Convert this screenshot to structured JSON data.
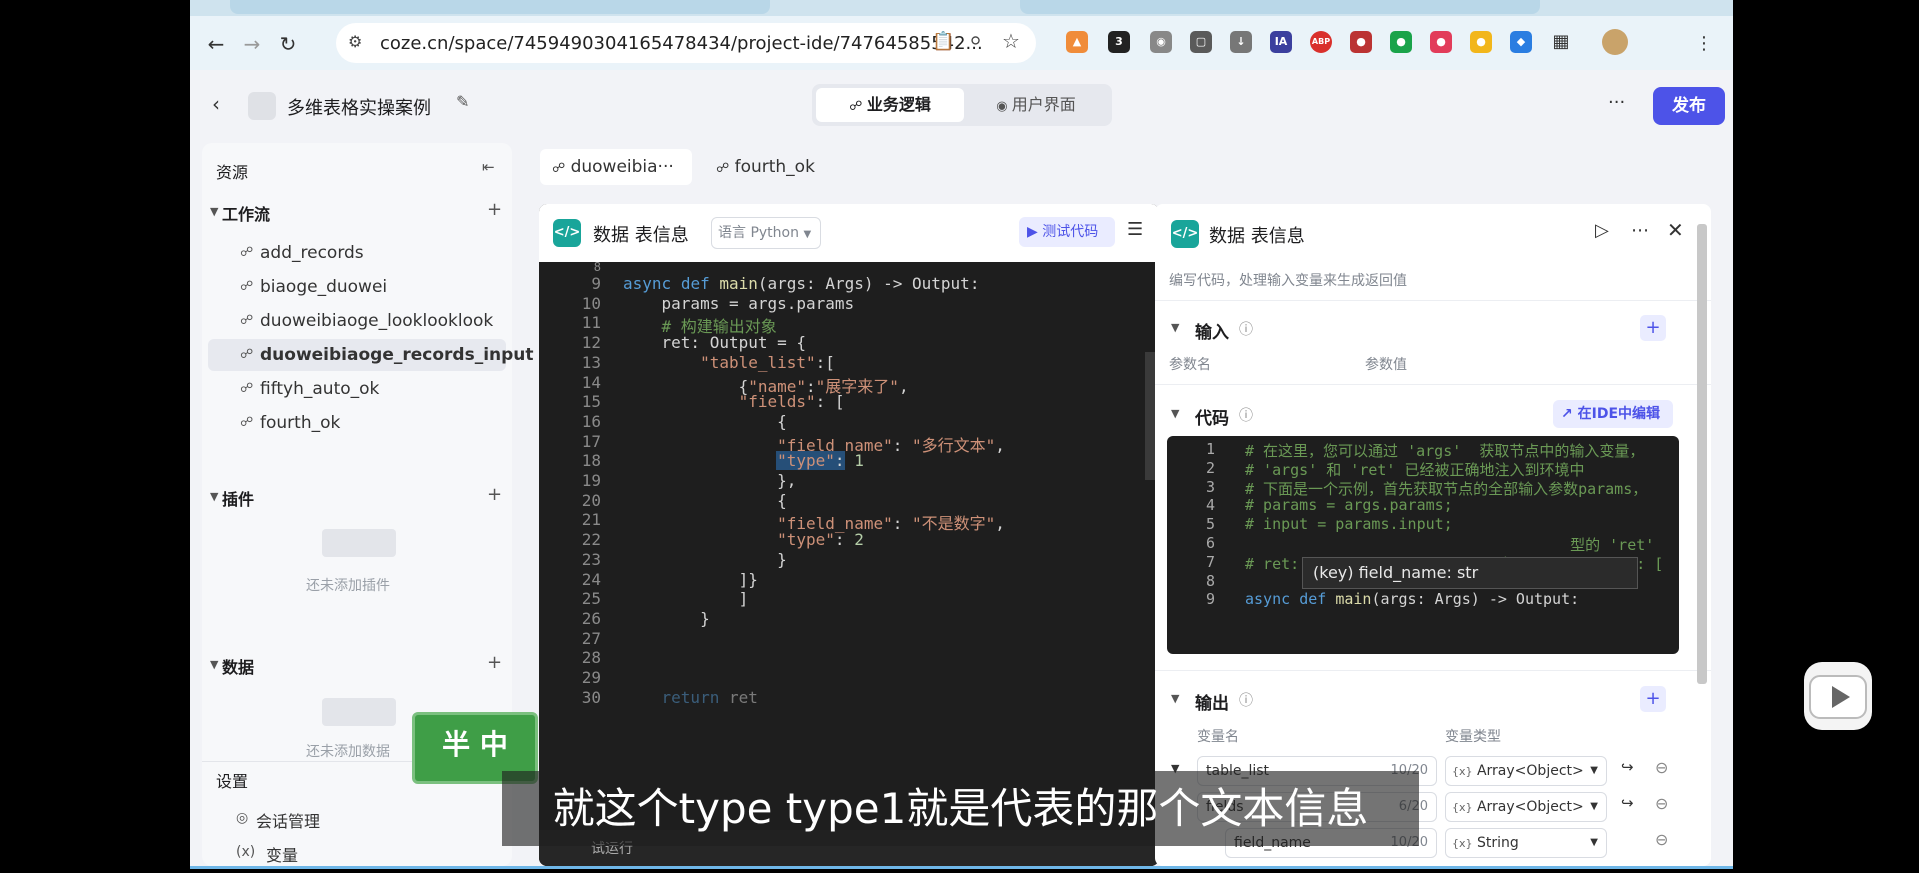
{
  "browser": {
    "url": "coze.cn/space/7459490304165478434/project-ide/74764585542...",
    "ext_badge": "3",
    "ext_ia": "IA",
    "ext_abp": "ABP"
  },
  "app": {
    "project_title": "多维表格实操案例",
    "seg_logic": "业务逻辑",
    "seg_ui": "用户界面",
    "more": "···",
    "publish": "发布"
  },
  "sidebar": {
    "resources": "资源",
    "workflow": "工作流",
    "plugins": "插件",
    "plugins_empty": "还未添加插件",
    "data": "数据",
    "data_empty": "还未添加数据",
    "settings": "设置",
    "session": "会话管理",
    "variables": "变量",
    "items": [
      "add_records",
      "biaoge_duowei",
      "duoweibiaoge_looklooklook",
      "duoweibiaoge_records_input",
      "fiftyh_auto_ok",
      "fourth_ok"
    ]
  },
  "editor_tabs": [
    "duoweibia···",
    "fourth_ok"
  ],
  "node": {
    "title": "数据 表信息",
    "lang": "语言 Python",
    "test": "测试代码",
    "partial_line_no": "8",
    "lines": [
      {
        "n": "9",
        "t": "async def main(args: Args) -> Output:"
      },
      {
        "n": "10",
        "t": "    params = args.params"
      },
      {
        "n": "11",
        "t": "    # 构建输出对象"
      },
      {
        "n": "12",
        "t": "    ret: Output = {"
      },
      {
        "n": "13",
        "t": "        \"table_list\":["
      },
      {
        "n": "14",
        "t": "            {\"name\":\"展字来了\","
      },
      {
        "n": "15",
        "t": "            \"fields\": ["
      },
      {
        "n": "16",
        "t": "                {"
      },
      {
        "n": "17",
        "t": "                \"field_name\": \"多行文本\","
      },
      {
        "n": "18",
        "t": "                \"type\": 1"
      },
      {
        "n": "19",
        "t": "                },"
      },
      {
        "n": "20",
        "t": "                {"
      },
      {
        "n": "21",
        "t": "                \"field_name\": \"不是数字\","
      },
      {
        "n": "22",
        "t": "                \"type\": 2"
      },
      {
        "n": "23",
        "t": "                }"
      },
      {
        "n": "24",
        "t": "            ]}"
      },
      {
        "n": "25",
        "t": "            ]"
      },
      {
        "n": "26",
        "t": "        }"
      },
      {
        "n": "27",
        "t": ""
      },
      {
        "n": "28",
        "t": ""
      },
      {
        "n": "29",
        "t": ""
      },
      {
        "n": "30",
        "t": "    return ret"
      }
    ],
    "bottom_label": "试运行"
  },
  "config": {
    "title": "数据 表信息",
    "desc": "编写代码，处理输入变量来生成返回值",
    "input": "输入",
    "param_name": "参数名",
    "param_value": "参数值",
    "code": "代码",
    "ide_edit": "在IDE中编辑",
    "mini_lines": [
      {
        "n": "1",
        "t": "# 在这里，您可以通过 'args'  获取节点中的输入变量，"
      },
      {
        "n": "2",
        "t": "# 'args' 和 'ret' 已经被正确地注入到环境中"
      },
      {
        "n": "3",
        "t": "# 下面是一个示例，首先获取节点的全部输入参数params，"
      },
      {
        "n": "4",
        "t": "# params = args.params;"
      },
      {
        "n": "5",
        "t": "# input = params.input;"
      },
      {
        "n": "6",
        "t": "                                    型的 'ret'"
      },
      {
        "n": "7",
        "t": "# ret: Output =  { \"name\": '小明', \"hobbies\": ["
      },
      {
        "n": "8",
        "t": ""
      },
      {
        "n": "9",
        "t": "async def main(args: Args) -> Output:"
      }
    ],
    "output": "输出",
    "var_name": "变量名",
    "var_type": "变量类型",
    "vars": [
      {
        "name": "table_list",
        "count": "10/20",
        "type": "Array<Object>"
      },
      {
        "name": "fields",
        "count": "6/20",
        "type": "Array<Object>"
      },
      {
        "name": "field_name",
        "count": "10/20",
        "type": "String"
      }
    ]
  },
  "tooltip": "(key) field_name: str",
  "subtitle": "就这个type type1就是代表的那个文本信息",
  "sticker": "半 中"
}
